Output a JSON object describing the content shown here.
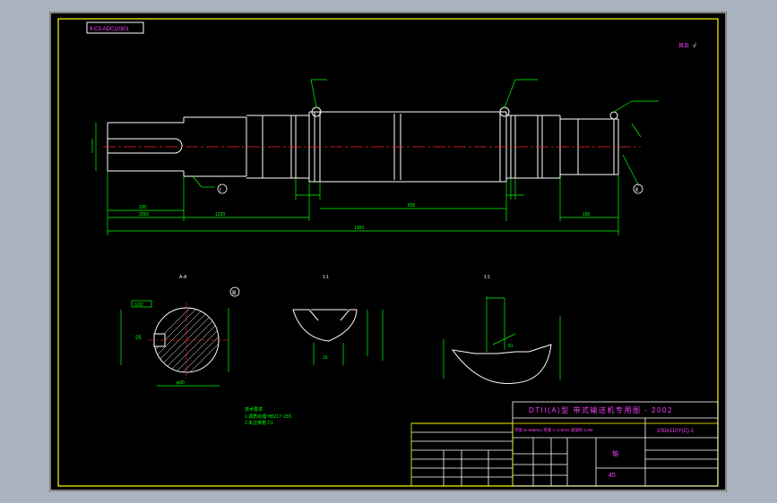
{
  "drawing": {
    "code_box": "Ⅱ-C3-ADC10301",
    "roughness_note": "其余",
    "roughness_value": "√"
  },
  "views": {
    "section_a": "A-A",
    "section_b": "1:1",
    "section_c": "1:1"
  },
  "labels": {
    "datum_1": "Ⅰ",
    "datum_2": "Ⅱ",
    "datum_3": "Ⅲ",
    "keyway_tol": "0.02"
  },
  "dimensions": {
    "d1": "1300",
    "d2": "835",
    "d3": "2050",
    "d4": "1220",
    "d5": "230",
    "d6": "160",
    "d7": "φ90",
    "d8": "55",
    "d9": "25",
    "d10": "16",
    "d11": "81"
  },
  "notes": {
    "tech_title": "技术要求",
    "line1": "1.调质处理 HB217~255",
    "line2": "2.未注倒角 C1"
  },
  "title_block": {
    "product_title": "DTII(A)型  带式输送机专用图 - 2002",
    "drawing_number": "100A110Y(C)-1",
    "part_name": "轴",
    "material": "45",
    "spec_line": "带宽 B=650mm  带速 V=2.0m/s  减速机 0.2M"
  }
}
